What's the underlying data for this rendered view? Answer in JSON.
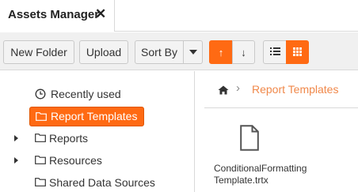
{
  "tab": {
    "title": "Assets Manager",
    "close_glyph": "✕"
  },
  "toolbar": {
    "new_folder_label": "New Folder",
    "upload_label": "Upload",
    "sort_by_label": "Sort By",
    "sort_ascending_glyph": "↑",
    "sort_descending_glyph": "↓",
    "active_sort": "ascending",
    "active_view": "grid",
    "accent_color": "#ff6a13"
  },
  "tree": {
    "items": [
      {
        "label": "Recently used",
        "icon": "clock-icon",
        "selected": false,
        "expandable": false
      },
      {
        "label": "Report Templates",
        "icon": "folder-icon",
        "selected": true,
        "expandable": false
      },
      {
        "label": "Reports",
        "icon": "folder-icon",
        "selected": false,
        "expandable": true
      },
      {
        "label": "Resources",
        "icon": "folder-icon",
        "selected": false,
        "expandable": true
      },
      {
        "label": "Shared Data Sources",
        "icon": "folder-icon",
        "selected": false,
        "expandable": false
      }
    ]
  },
  "breadcrumb": {
    "home_icon": "home-icon",
    "separator": "›",
    "current": "Report Templates"
  },
  "files": [
    {
      "name": "ConditionalFormattingTemplate.trtx",
      "icon": "file-icon"
    }
  ]
}
